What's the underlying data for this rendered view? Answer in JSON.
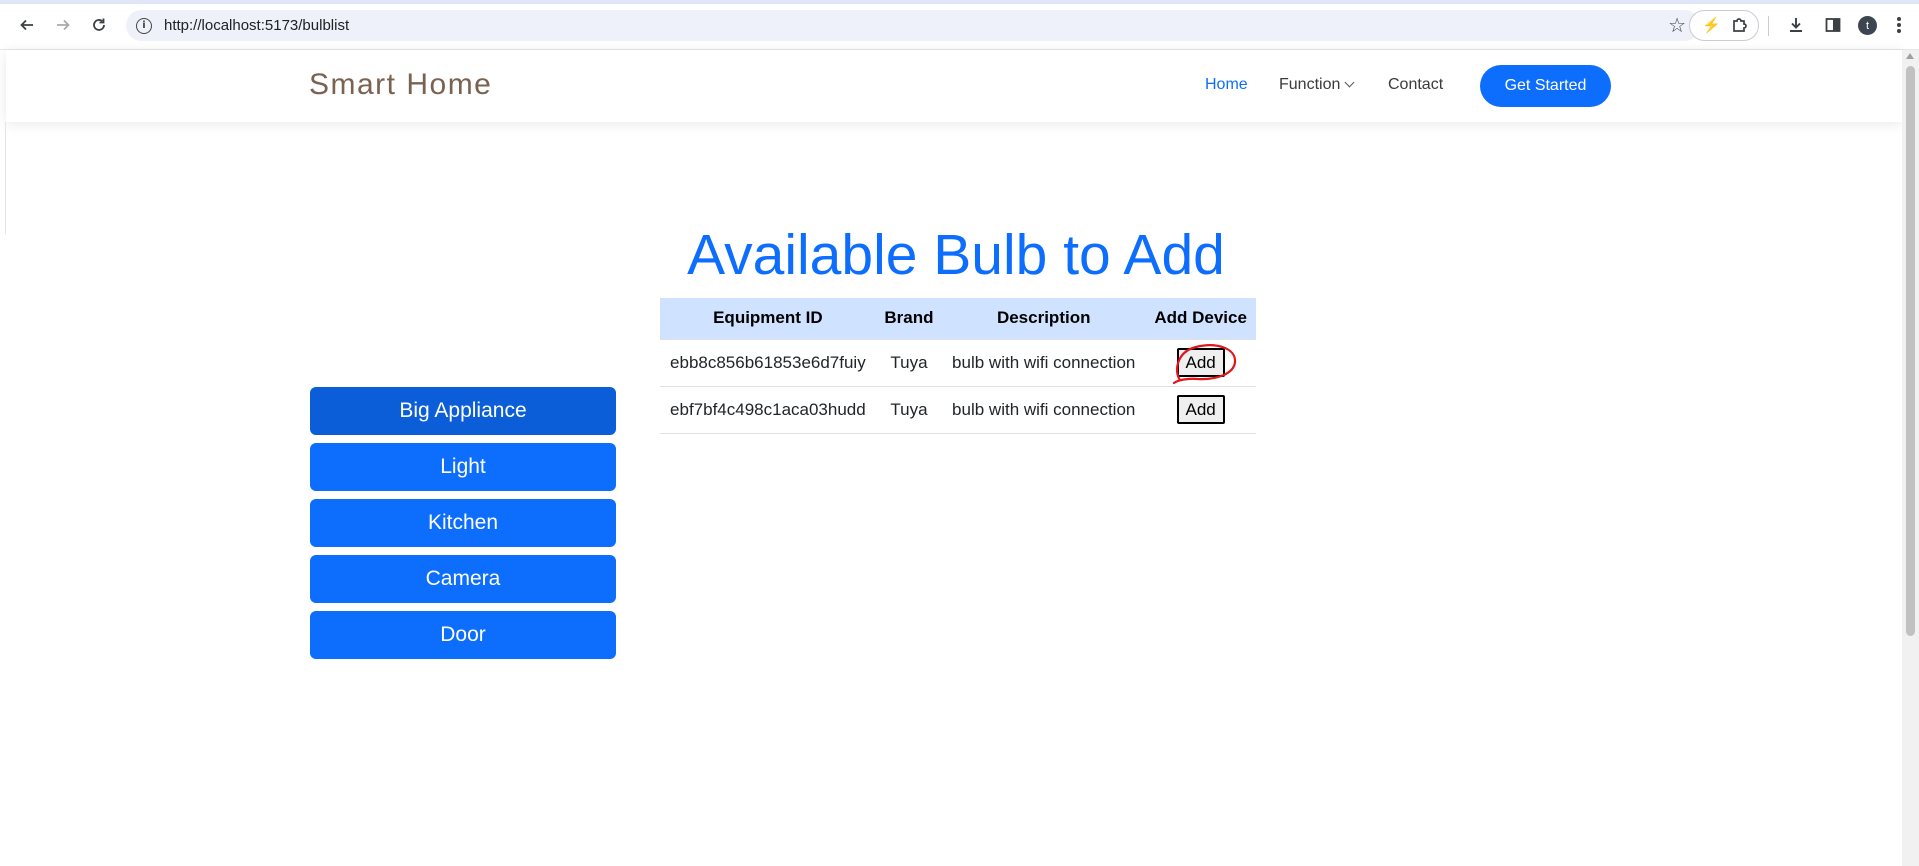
{
  "browser": {
    "url": "http://localhost:5173/bulblist",
    "profile_initial": "t"
  },
  "navbar": {
    "brand": "Smart Home",
    "links": [
      {
        "label": "Home",
        "active": true
      },
      {
        "label": "Function",
        "has_dropdown": true
      },
      {
        "label": "Contact"
      }
    ],
    "cta_label": "Get Started"
  },
  "page_title": "Available Bulb to Add",
  "categories": [
    {
      "label": "Big Appliance",
      "active": true
    },
    {
      "label": "Light"
    },
    {
      "label": "Kitchen"
    },
    {
      "label": "Camera"
    },
    {
      "label": "Door"
    }
  ],
  "table": {
    "headers": [
      "Equipment ID",
      "Brand",
      "Description",
      "Add Device"
    ],
    "rows": [
      {
        "id": "ebb8c856b61853e6d7fuiy",
        "brand": "Tuya",
        "description": "bulb with wifi connection",
        "action": "Add"
      },
      {
        "id": "ebf7bf4c498c1aca03hudd",
        "brand": "Tuya",
        "description": "bulb with wifi connection",
        "action": "Add"
      }
    ]
  },
  "colors": {
    "primary": "#0d6efd",
    "primary_active": "#0b5ed7",
    "table_header_bg": "#cfe2ff",
    "brand_text": "#7a6253",
    "annotation": "#e0161b"
  },
  "icons": [
    "back-arrow-icon",
    "forward-arrow-icon",
    "reload-icon",
    "info-icon",
    "star-icon",
    "bolt-icon",
    "extensions-icon",
    "download-icon",
    "side-panel-icon",
    "kebab-menu-icon",
    "chevron-down-icon"
  ]
}
